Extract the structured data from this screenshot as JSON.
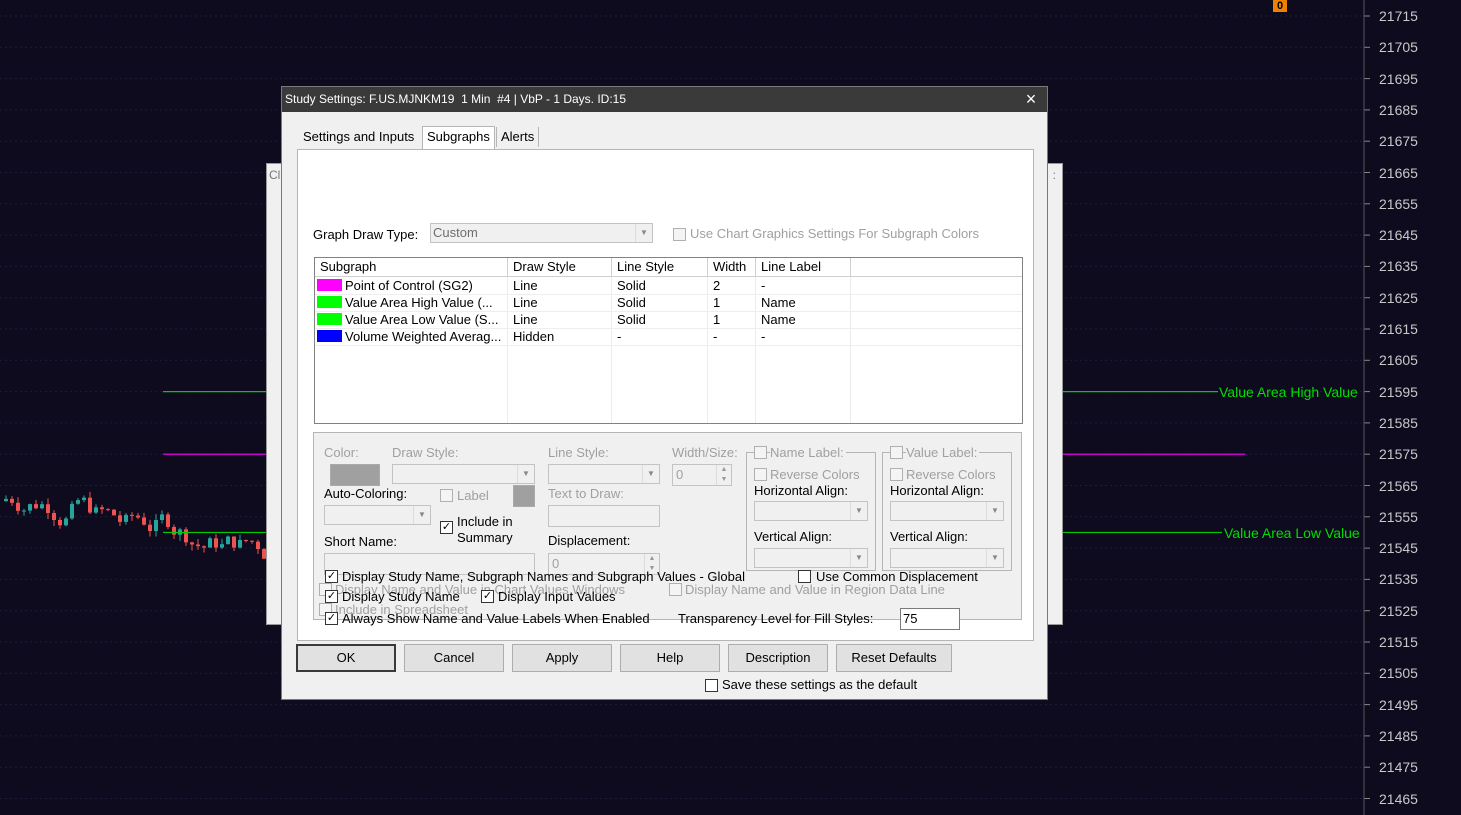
{
  "chart": {
    "price_axis": [
      "21715",
      "21705",
      "21695",
      "21685",
      "21675",
      "21665",
      "21655",
      "21645",
      "21635",
      "21625",
      "21615",
      "21605",
      "21595",
      "21585",
      "21575",
      "21565",
      "21555",
      "21545",
      "21535",
      "21525",
      "21515",
      "21505",
      "21495",
      "21485",
      "21475",
      "21465"
    ],
    "lines": [
      {
        "label": "Value Area High Value",
        "price": 21595,
        "color": "#00cc00"
      },
      {
        "label": "",
        "price": 21575,
        "color": "#ff00ff"
      },
      {
        "label": "Value Area Low Value",
        "price": 21550,
        "color": "#00cc00"
      }
    ],
    "marker_badge": "0",
    "background_window_title_stub": "Cl",
    "background_window_mark": ":",
    "up_color": "#26a69a",
    "down_color": "#ef5350"
  },
  "dialog": {
    "title": "Study Settings: F.US.MJNKM19  1 Min  #4 | VbP - 1 Days. ID:15",
    "close_icon": "×",
    "tabs": [
      {
        "label": "Settings and Inputs",
        "active": false
      },
      {
        "label": "Subgraphs",
        "active": true
      },
      {
        "label": "Alerts",
        "active": false
      }
    ],
    "graph_draw_type_label": "Graph Draw Type:",
    "graph_draw_type_value": "Custom",
    "use_chart_graphics_label": "Use Chart Graphics Settings For Subgraph Colors",
    "grid": {
      "columns": [
        "Subgraph",
        "Draw Style",
        "Line Style",
        "Width",
        "Line Label"
      ],
      "rows": [
        {
          "color": "#ff00ff",
          "subgraph": "Point of Control (SG2)",
          "draw_style": "Line",
          "line_style": "Solid",
          "width": "2",
          "line_label": "-"
        },
        {
          "color": "#00ff00",
          "subgraph": "Value Area High Value (...",
          "draw_style": "Line",
          "line_style": "Solid",
          "width": "1",
          "line_label": "Name"
        },
        {
          "color": "#00ff00",
          "subgraph": "Value Area Low Value (S...",
          "draw_style": "Line",
          "line_style": "Solid",
          "width": "1",
          "line_label": "Name"
        },
        {
          "color": "#0000ff",
          "subgraph": "Volume Weighted Averag...",
          "draw_style": "Hidden",
          "line_style": "-",
          "width": "-",
          "line_label": "-"
        }
      ]
    },
    "details": {
      "color_label": "Color:",
      "draw_style_label": "Draw Style:",
      "line_style_label": "Line Style:",
      "width_size_label": "Width/Size:",
      "width_value": "0",
      "name_label_label": "Name Label:",
      "value_label_label": "Value Label:",
      "reverse_colors_label": "Reverse Colors",
      "horizontal_align_label": "Horizontal Align:",
      "vertical_align_label": "Vertical Align:",
      "auto_coloring_label": "Auto-Coloring:",
      "label_label": "Label",
      "text_to_draw_label": "Text to Draw:",
      "include_in_summary_label_1": "Include in",
      "include_in_summary_label_2": "Summary",
      "short_name_label": "Short Name:",
      "displacement_label": "Displacement:",
      "displacement_value": "0",
      "display_in_chart_values_label": "Display Name and Value in Chart Values Windows",
      "display_in_region_data_label": "Display Name and Value in Region Data Line",
      "include_in_spreadsheet_label": "Include in Spreadsheet"
    },
    "options": {
      "display_study_name_subgraphs_label": "Display Study Name, Subgraph Names and Subgraph Values - Global",
      "use_common_displacement_label": "Use Common Displacement",
      "display_study_name_label": "Display Study Name",
      "display_input_values_label": "Display Input Values",
      "always_show_name_label": "Always Show Name and Value Labels When Enabled",
      "transparency_label": "Transparency Level for Fill Styles:",
      "transparency_value": "75"
    },
    "buttons": {
      "ok": "OK",
      "cancel": "Cancel",
      "apply": "Apply",
      "help": "Help",
      "description": "Description",
      "reset_defaults": "Reset Defaults"
    },
    "save_default_label": "Save these settings as the default",
    "check_mark": "✓"
  }
}
